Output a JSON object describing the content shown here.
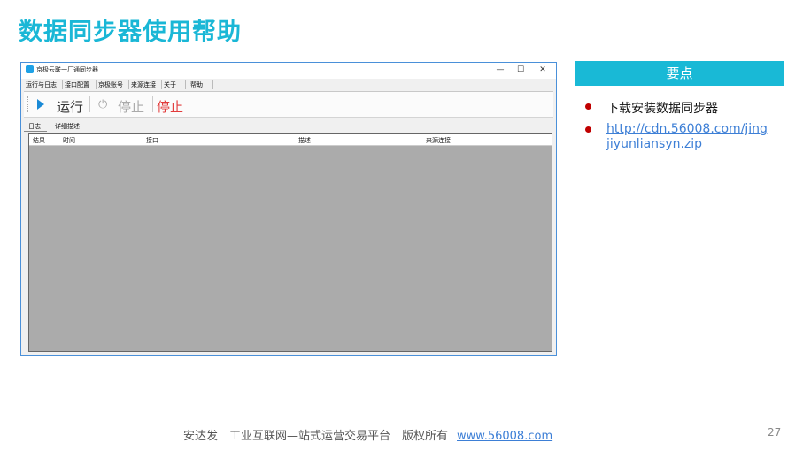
{
  "slide": {
    "title": "数据同步器使用帮助",
    "page_number": "27"
  },
  "window": {
    "title": "京极云联一厂通同步器",
    "controls": {
      "minimize": "—",
      "maximize": "☐",
      "close": "✕"
    },
    "menu": [
      "运行与日志",
      "接口配置",
      "京极账号",
      "来源连接",
      "关于",
      "帮助"
    ],
    "toolbar": {
      "run": "运行",
      "stop_disabled": "停止",
      "stop": "停止",
      "power_icon": "⏻"
    },
    "tabs": [
      "日志",
      "详细描述"
    ],
    "columns": [
      "结果",
      "时间",
      "接口",
      "描述",
      "来源连接"
    ]
  },
  "key_points": {
    "header": "要点",
    "items": [
      {
        "text": "下载安装数据同步器"
      },
      {
        "text": "http://cdn.56008.com/jingjiyunliansyn.zip"
      }
    ]
  },
  "footer": {
    "text": "安达发　工业互联网—站式运营交易平台　版权所有",
    "link": "www.56008.com"
  },
  "colors": {
    "accent": "#19b9d6",
    "bullet": "#c00000",
    "link": "#3d7fd6",
    "stop": "#e23b3b"
  }
}
